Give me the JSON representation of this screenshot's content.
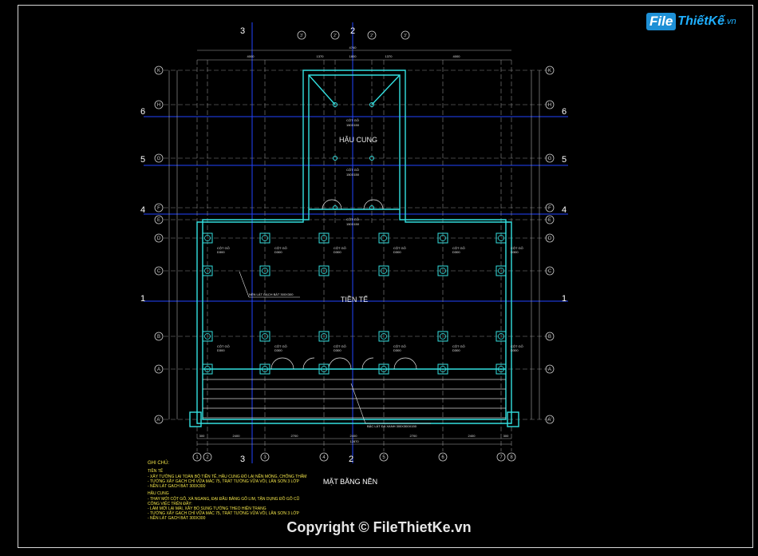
{
  "drawing": {
    "title": "MẶT BẰNG NỀN",
    "room_upper": "HẬU CUNG",
    "room_lower": "TIỀN TẾ",
    "column_label_upper": "CỘT GỖ",
    "column_size_upper": "150X150",
    "column_label": "CỘT GỖ",
    "column_size": "D300",
    "annotation_floor": "NỀN LÁT GẠCH BÁT 300X300",
    "annotation_step": "BẬC LÁT ĐÁ XANH 300X300X150"
  },
  "axes": {
    "left_letters": [
      "K",
      "H",
      "G",
      "F",
      "E",
      "D",
      "C",
      "B",
      "A",
      "A'"
    ],
    "left_numbers": [
      "6",
      "5",
      "4",
      "1"
    ],
    "top_marks": [
      "3",
      "2",
      "3'",
      "2'",
      "2'",
      "3'"
    ],
    "bottom_numbers": [
      "1",
      "2",
      "3",
      "4",
      "5",
      "6",
      "7",
      "8"
    ],
    "bottom_big": [
      "3",
      "2"
    ]
  },
  "dimensions": {
    "top": [
      "4000",
      "1370",
      "1800",
      "1370",
      "4000",
      "4740"
    ],
    "bottom": [
      "300",
      "2400",
      "2700",
      "2400",
      "2700",
      "2400",
      "300",
      "12870"
    ]
  },
  "notes": {
    "heading": "GHI CHÚ:",
    "group1": "TIỀN TẾ",
    "lines1": [
      "- XÂY TƯỜNG LẠI TOÀN BỘ TIỀN TẾ, HẬU CUNG ĐỔ LẠI NỀN MÓNG, CHỐNG THẤM",
      "- TƯỜNG XÂY GẠCH CHỈ VỮA MÁC 75, TRÁT TƯỜNG VỮA VÔI, LĂN SƠN 3 LỚP",
      "- NỀN LÁT GẠCH BÁT 300X300"
    ],
    "group2": "HẬU CUNG",
    "lines2": [
      "- THAY MỚI CỘT GỖ, XÀ NGANG, ĐẠI ĐẦU BẢNG GỖ LIM, TẬN DỤNG ĐỒ GỖ CŨ",
      "CÔNG VIỆC TRÊN ĐÂY:",
      "- LÀM MỚI LẠI MÁI, XÂY BỔ SUNG TƯỜNG THEO HIỆN TRẠNG",
      "- TƯỜNG XÂY GẠCH CHỈ VỮA MÁC 75, TRÁT TƯỜNG VỮA VÔI, LĂN SƠN 3 LỚP",
      "- NỀN LÁT GẠCH BÁT 300X300"
    ]
  },
  "branding": {
    "logo_file": "File",
    "logo_rest": "ThiếtKế",
    "logo_domain": ".vn",
    "copyright": "Copyright © FileThietKe.vn"
  }
}
